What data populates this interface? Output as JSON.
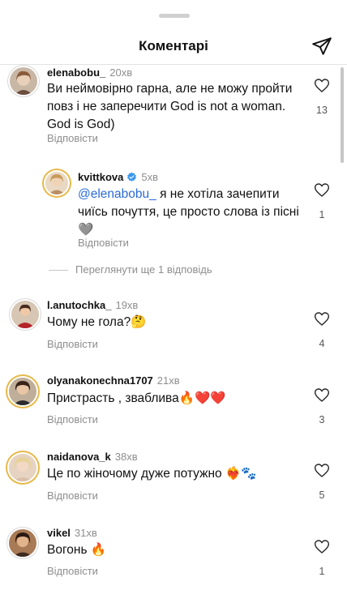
{
  "header": {
    "title": "Коментарі"
  },
  "reply_label": "Відповісти",
  "view_more_label": "Переглянути ще 1 відповідь",
  "colors": {
    "accent_mention": "#2a6bd6",
    "meta_grey": "#8e8e8e",
    "story_ring": "#e7b94a"
  },
  "comments": [
    {
      "user": "elenabobu_",
      "time": "20хв",
      "text": "Ви неймовірно гарна, але не можу пройти повз і не заперечити God is not a woman. God is God)",
      "likes": "13"
    },
    {
      "user": "kvittkova",
      "time": "5хв",
      "verified": true,
      "mention": "@elenabobu_",
      "text": " я не хотіла зачепити чиїсь почуття, це просто слова із пісні",
      "emoji": "🩶",
      "likes": "1"
    },
    {
      "user": "l.anutochka_",
      "time": "19хв",
      "text": "Чому не гола?",
      "emoji": "🤔",
      "likes": "4"
    },
    {
      "user": "olyanakonechna1707",
      "time": "21хв",
      "text": "Пристрасть , зваблива",
      "emoji": "🔥❤️❤️",
      "likes": "3"
    },
    {
      "user": "naidanova_k",
      "time": "38хв",
      "text": "Це по жіночому дуже потужно",
      "emoji": "❤️‍🔥🐾",
      "likes": "5"
    },
    {
      "user": "vikel",
      "time": "31хв",
      "text": "Вогонь",
      "emoji": "🔥",
      "likes": "1"
    }
  ]
}
